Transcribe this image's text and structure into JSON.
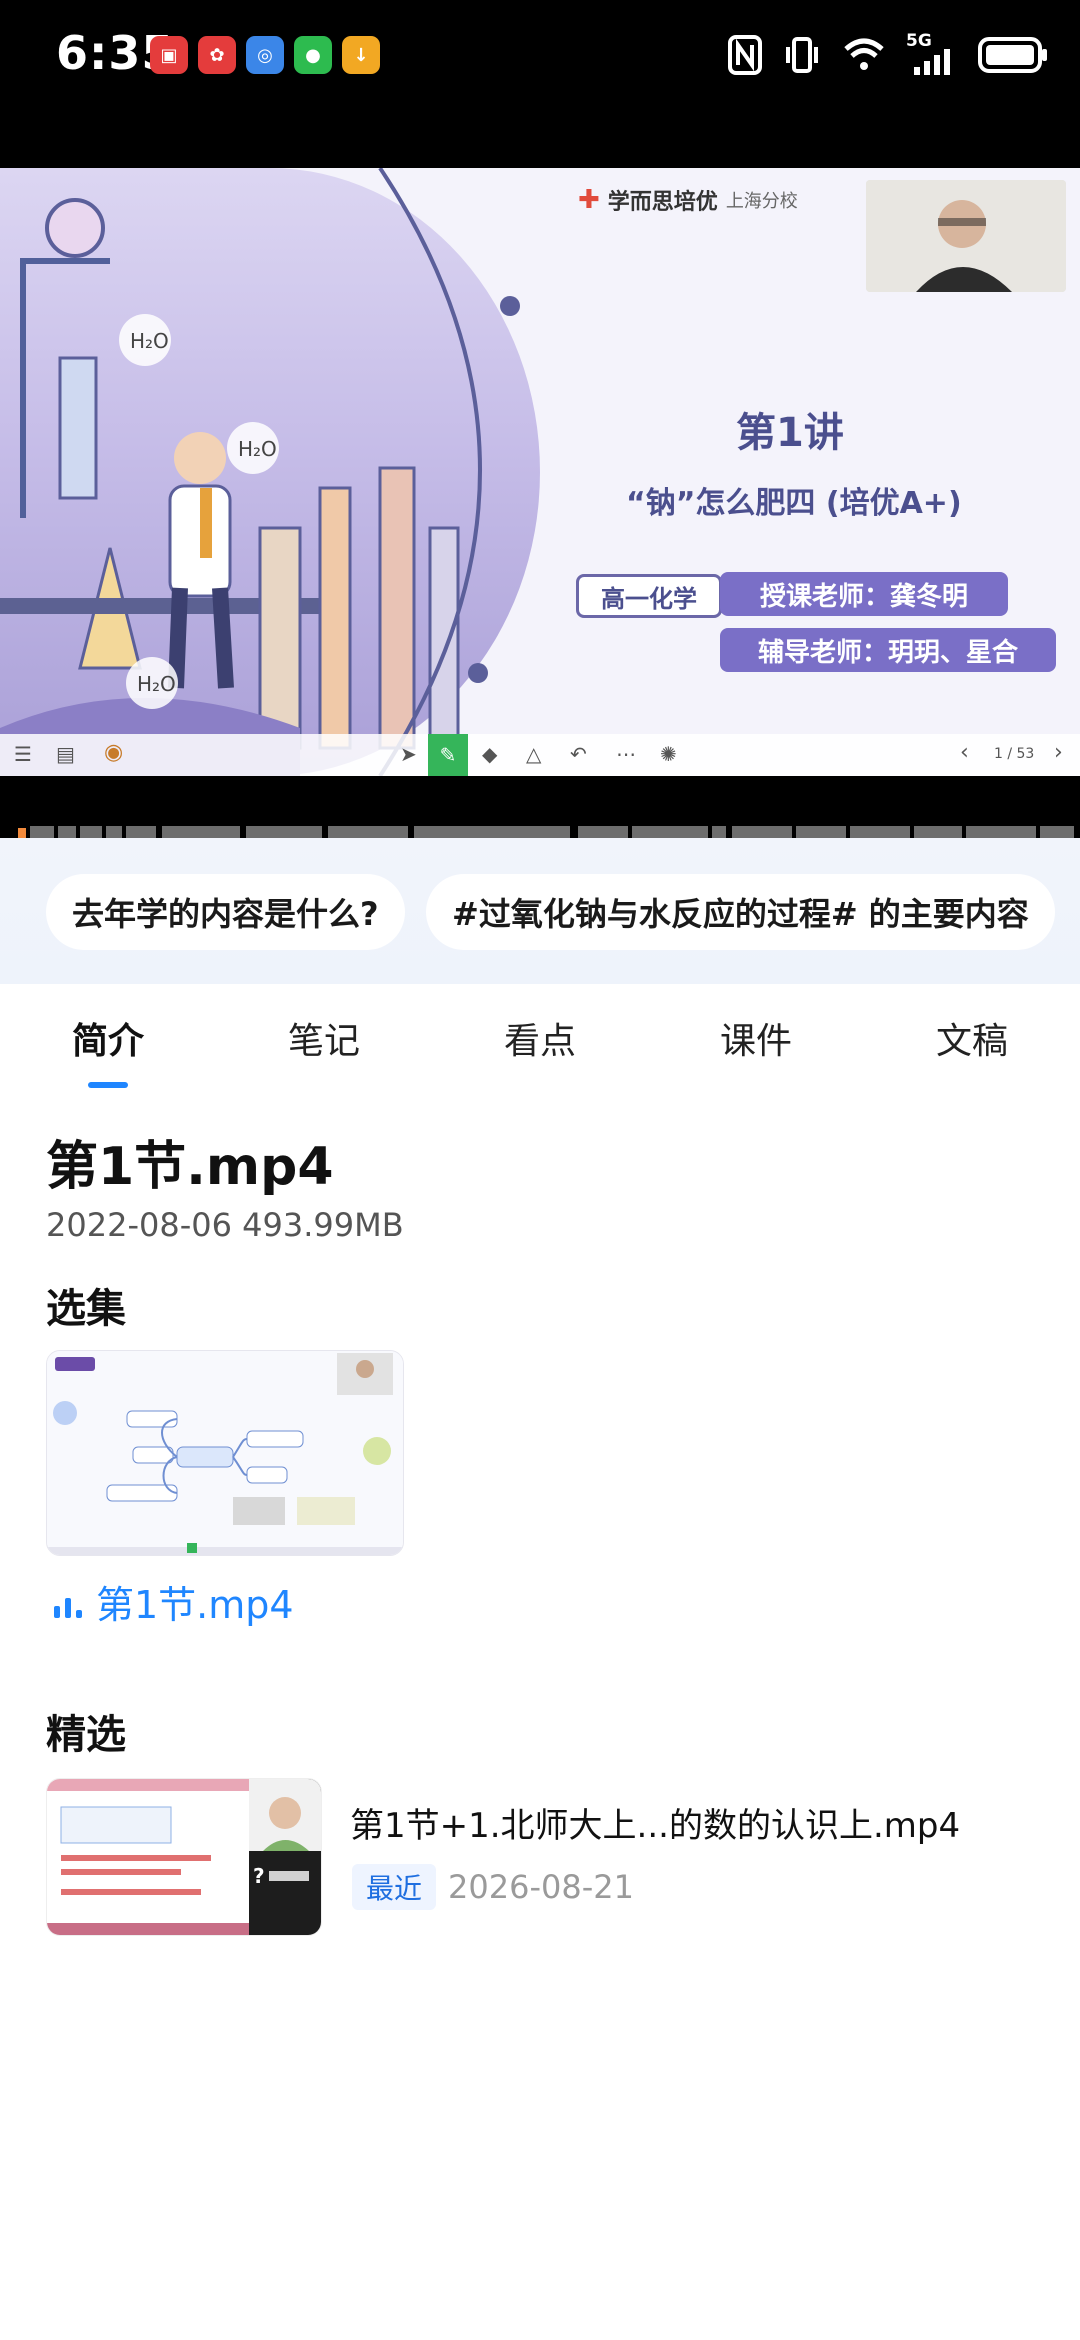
{
  "status_bar": {
    "time": "6:35",
    "apps": [
      "app-icon-1",
      "app-icon-2",
      "app-icon-3",
      "app-icon-4",
      "app-icon-5"
    ],
    "network": "5G"
  },
  "video": {
    "brand": "学而思培优",
    "branch": "上海分校",
    "lecture": "第1讲",
    "subtitle": "“钠”怎么肥四 (培优A+)",
    "course": "高一化学",
    "teacher": "授课老师：龚冬明",
    "assistant": "辅导老师：玥玥、星合",
    "page_counter": "1 / 53",
    "h2o": "H₂O"
  },
  "chips": [
    "去年学的内容是什么?",
    "#过氧化钠与水反应的过程# 的主要内容"
  ],
  "tabs": [
    "简介",
    "笔记",
    "看点",
    "课件",
    "文稿"
  ],
  "detail": {
    "title": "第1节.mp4",
    "meta": "2022-08-06   493.99MB",
    "episodes_heading": "选集",
    "episode_label": "第1节.mp4",
    "featured_heading": "精选",
    "rec_title": "第1节+1.北师大上...的数的认识上.mp4",
    "rec_badge": "最近",
    "rec_date": "2026-08-21"
  },
  "colors": {
    "accent": "#1f86ff",
    "chip_bg": "#ffffff",
    "status_bg": "#000000"
  }
}
